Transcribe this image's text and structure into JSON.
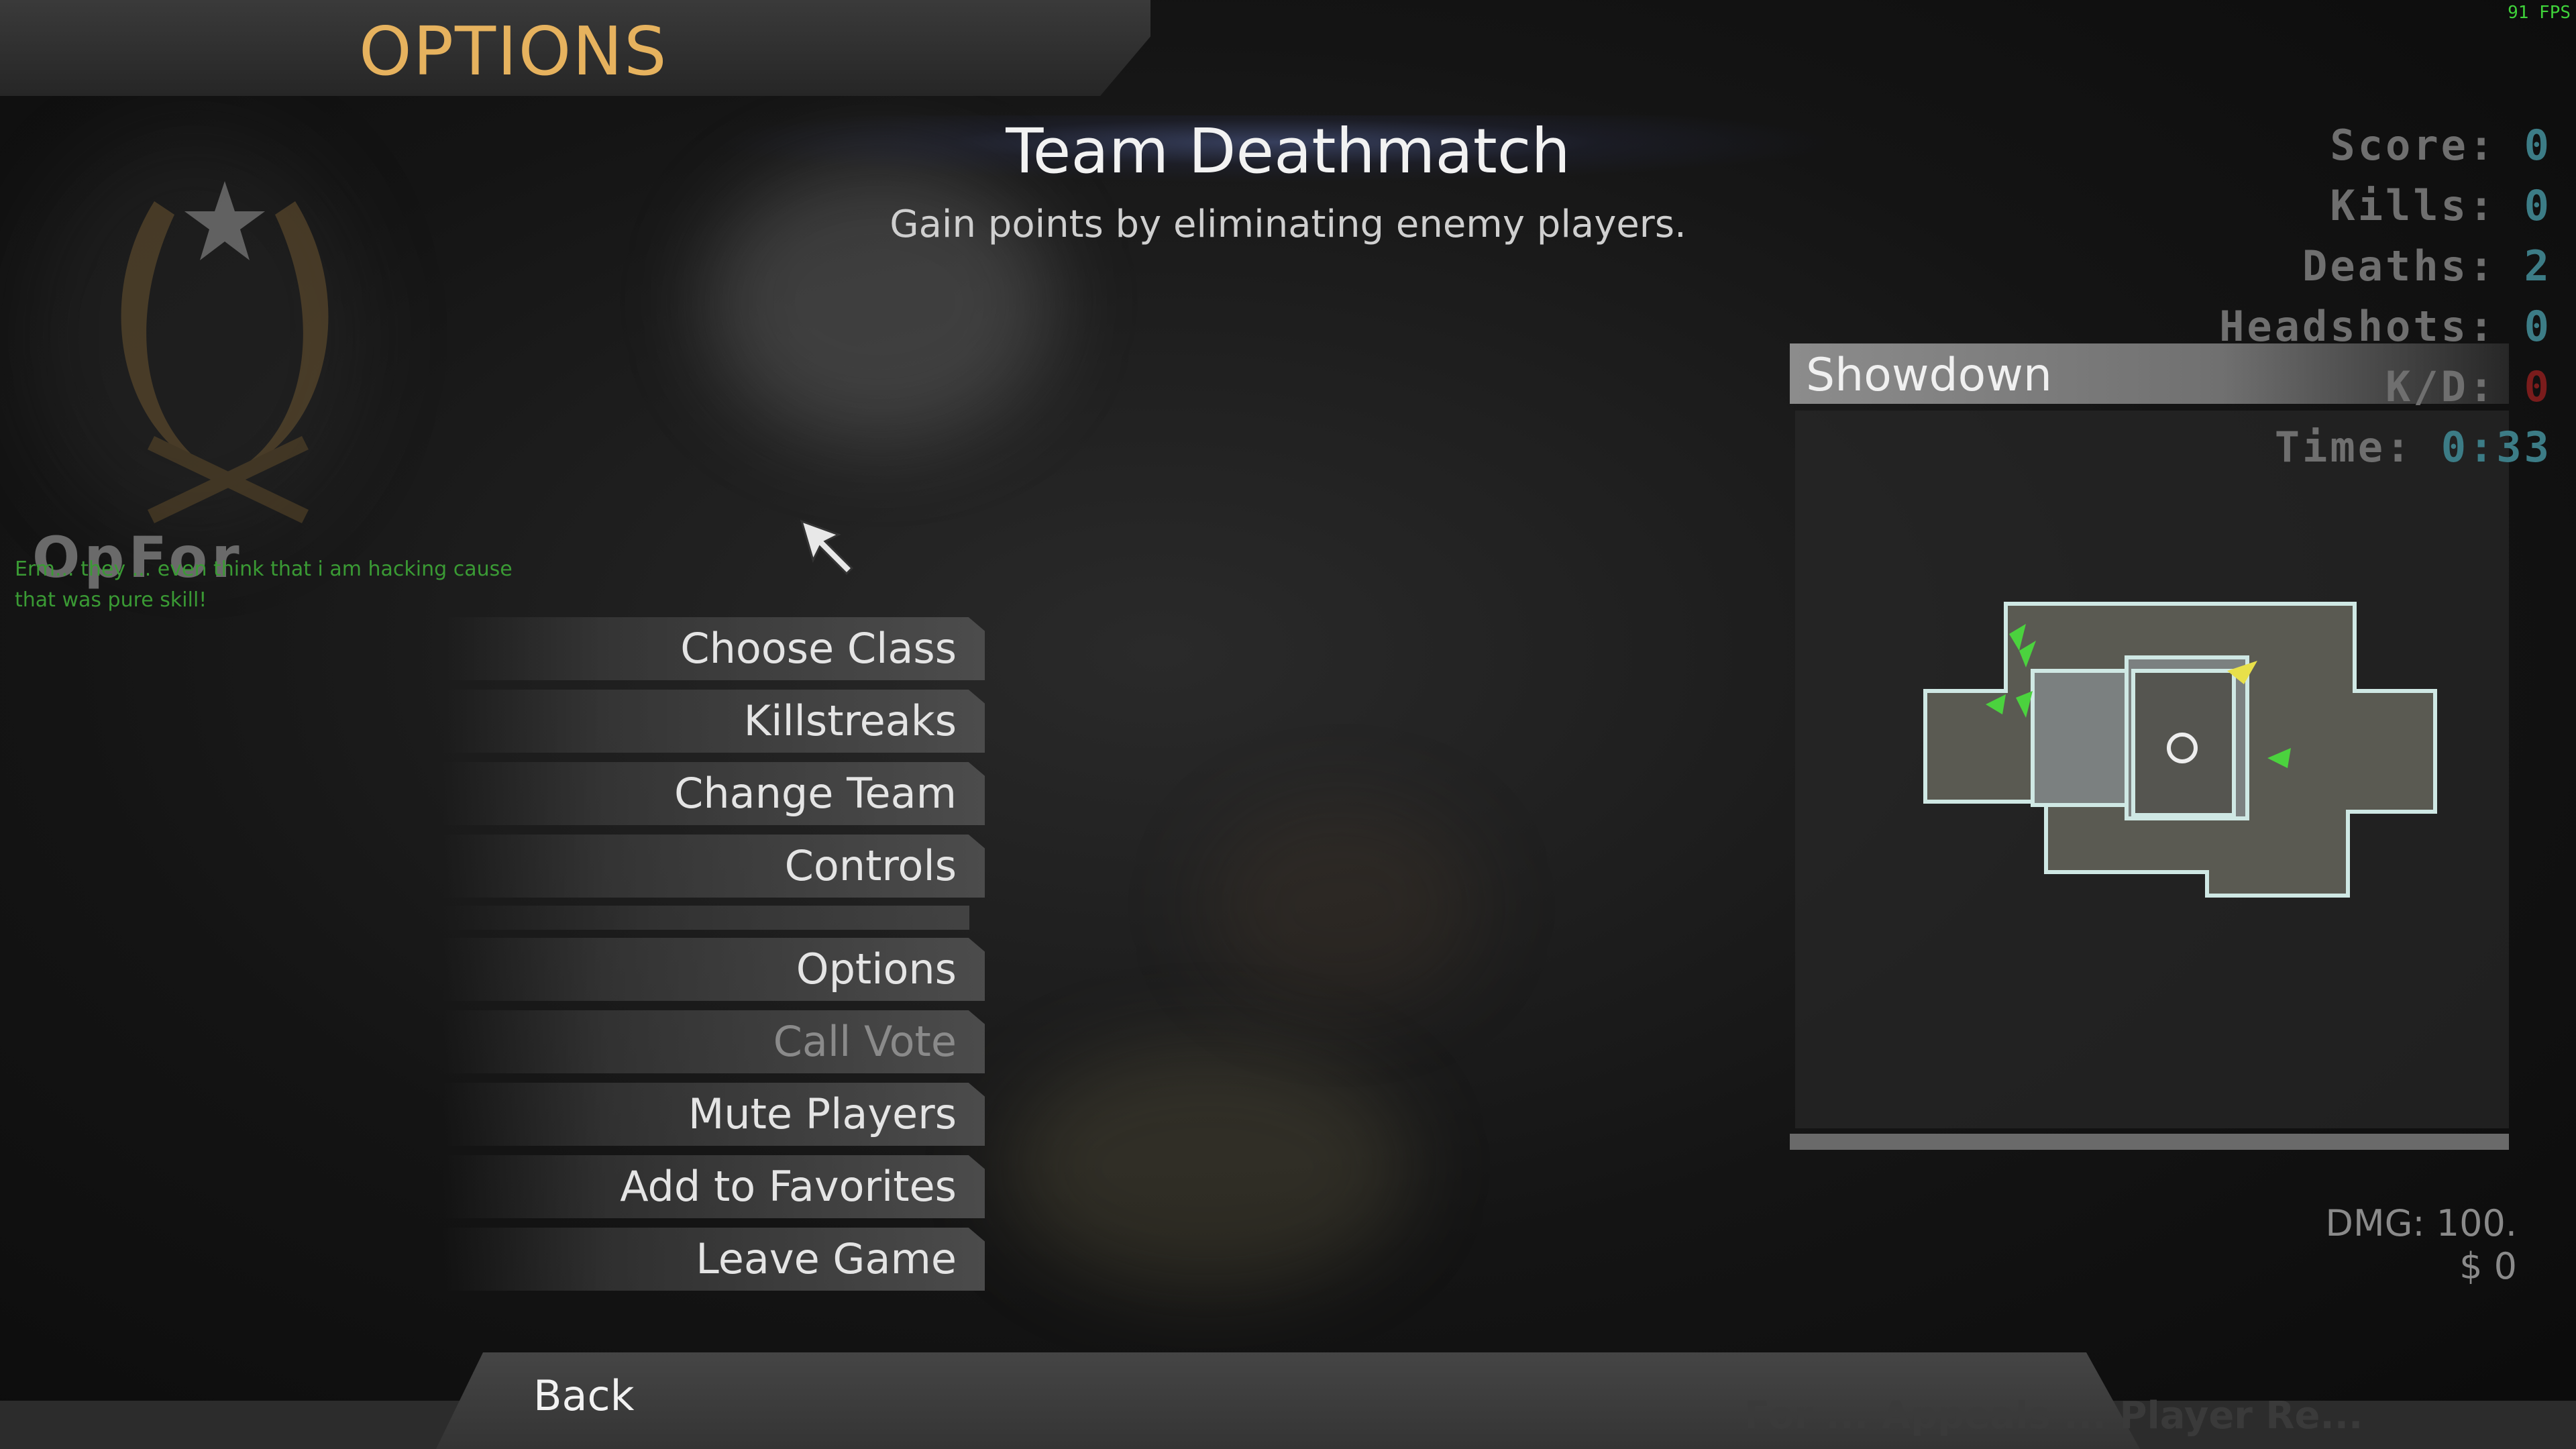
{
  "header": {
    "title": "OPTIONS",
    "fps": "91 FPS"
  },
  "team": {
    "faction": "OpFor"
  },
  "chat": {
    "message": "Erm... they ... even think that i am hacking cause that was pure skill!"
  },
  "mode": {
    "title": "Team Deathmatch",
    "description": "Gain points by eliminating enemy players."
  },
  "menu": {
    "choose_class": "Choose Class",
    "killstreaks": "Killstreaks",
    "change_team": "Change Team",
    "controls": "Controls",
    "options": "Options",
    "call_vote": "Call Vote",
    "mute_players": "Mute Players",
    "add_to_favorites": "Add to Favorites",
    "leave_game": "Leave Game"
  },
  "stats": {
    "score_label": "Score:",
    "score": "0",
    "kills_label": "Kills:",
    "kills": "0",
    "deaths_label": "Deaths:",
    "deaths": "2",
    "headshots_label": "Headshots:",
    "headshots": "0",
    "kd_label": "K/D:",
    "kd": "0",
    "time_label": "Time:",
    "time": "0:33"
  },
  "map": {
    "name": "Showdown"
  },
  "hud": {
    "dmg": "DMG: 100.",
    "money": "$ 0"
  },
  "footer": {
    "back_label": "Back",
    "ticker": "For ... Appeals ... Player Re..."
  },
  "colors": {
    "accent": "#e6b25e",
    "stat_value": "#3c7c86",
    "friendly": "#3fd23a",
    "self_marker": "#e8e04a"
  }
}
